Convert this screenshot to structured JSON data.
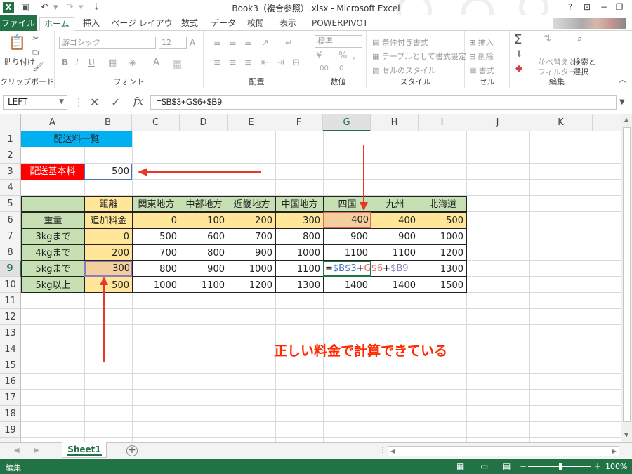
{
  "titlebar": {
    "title": "Book3（複合参照）.xlsx - Microsoft Excel",
    "undo": "↶",
    "redo": "↷",
    "help": "?",
    "minimize": "−",
    "restore": "❐",
    "close": "✕"
  },
  "tabs": [
    "ファイル",
    "ホーム",
    "挿入",
    "ページ レイアウト",
    "数式",
    "データ",
    "校閲",
    "表示",
    "POWERPIVOT"
  ],
  "ribbon": {
    "clipboard": {
      "paste": "貼り付け",
      "label": "クリップボード"
    },
    "font": {
      "name": "游ゴシック",
      "size": "12",
      "bold": "B",
      "italic": "I",
      "underline": "U",
      "grow": "A",
      "shrink": "A",
      "label": "フォント"
    },
    "alignment": {
      "label": "配置"
    },
    "number": {
      "format": "標準",
      "label": "数値"
    },
    "styles": {
      "conditional": "条件付き書式",
      "table": "テーブルとして書式設定",
      "cell_styles": "セルのスタイル",
      "label": "スタイル"
    },
    "cells": {
      "insert": "挿入",
      "delete": "削除",
      "format": "書式",
      "label": "セル"
    },
    "editing": {
      "sum": "Σ",
      "sort_filter_1": "並べ替えと",
      "sort_filter_2": "フィルター",
      "find_1": "検索と",
      "find_2": "選択",
      "label": "編集"
    }
  },
  "formula_bar": {
    "name_box": "LEFT",
    "formula": "=$B$3+G$6+$B9",
    "cancel": "✕",
    "enter": "✓",
    "fx": "fx"
  },
  "columns": [
    "A",
    "B",
    "C",
    "D",
    "E",
    "F",
    "G",
    "H",
    "I",
    "J",
    "K"
  ],
  "rows": [
    "1",
    "2",
    "3",
    "4",
    "5",
    "6",
    "7",
    "8",
    "9",
    "10",
    "11",
    "12",
    "13",
    "14",
    "15",
    "16",
    "17",
    "18",
    "19",
    "20"
  ],
  "cells": {
    "A1": "配送料一覧",
    "A3": "配送基本料",
    "B3": "500",
    "B5": "距離",
    "C5": "関東地方",
    "D5": "中部地方",
    "E5": "近畿地方",
    "F5": "中国地方",
    "G5": "四国",
    "H5": "九州",
    "I5": "北海道",
    "A6": "重量",
    "B6": "追加料金",
    "C6": "0",
    "D6": "100",
    "E6": "200",
    "F6": "300",
    "G6": "400",
    "H6": "400",
    "I6": "500",
    "A7": "3kgまで",
    "B7": "0",
    "C7": "500",
    "D7": "600",
    "E7": "700",
    "F7": "800",
    "G7": "900",
    "H7": "900",
    "I7": "1000",
    "A8": "4kgまで",
    "B8": "200",
    "C8": "700",
    "D8": "800",
    "E8": "900",
    "F8": "1000",
    "G8": "1100",
    "H8": "1100",
    "I8": "1200",
    "A9": "5kgまで",
    "B9": "300",
    "C9": "800",
    "D9": "900",
    "E9": "1000",
    "F9": "1100",
    "H9": "",
    "I9": "1300",
    "A10": "5kg以上",
    "B10": "500",
    "C10": "1000",
    "D10": "1100",
    "E10": "1200",
    "F10": "1300",
    "G10": "1400",
    "H10": "1400",
    "I10": "1500"
  },
  "edit_formula": {
    "eq": "=",
    "p1": "$B$3",
    "plus1": "+",
    "p2": "G$6",
    "plus2": "+",
    "p3": "$B9"
  },
  "annotation": "正しい料金で計算できている",
  "sheet_tab": "Sheet1",
  "add_sheet": "+",
  "status": {
    "mode": "編集",
    "zoom": "100%"
  },
  "colors": {
    "excel_green": "#217346",
    "header_cyan": "#00b0f0",
    "label_red": "#ff0000",
    "row_green": "#c6e0b4",
    "value_yellow": "#ffe699",
    "annotation_red": "#ff2a00"
  }
}
